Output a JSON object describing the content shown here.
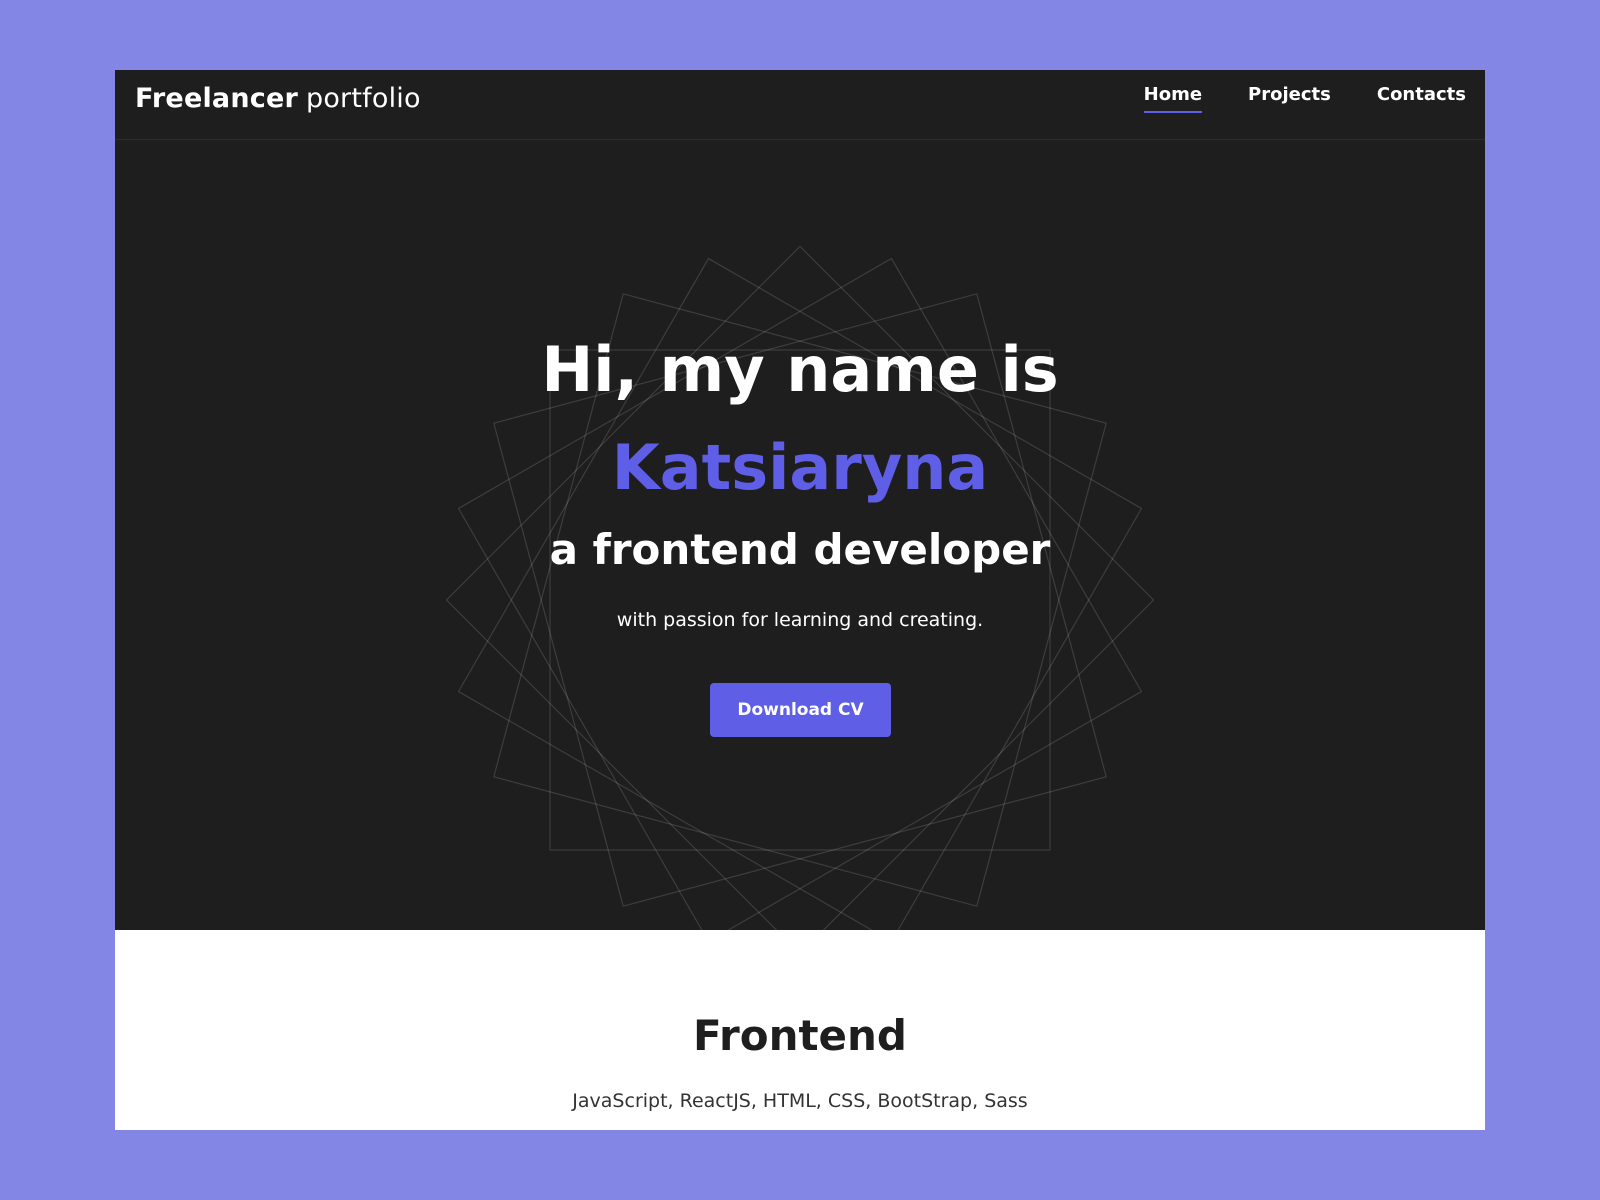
{
  "header": {
    "brand_bold": "Freelancer",
    "brand_light": "portfolio",
    "nav": [
      {
        "label": "Home",
        "active": true
      },
      {
        "label": "Projects",
        "active": false
      },
      {
        "label": "Contacts",
        "active": false
      }
    ]
  },
  "hero": {
    "greeting": "Hi, my name is",
    "name": "Katsiaryna",
    "role": "a frontend developer",
    "tagline": "with passion for learning and creating.",
    "cta_label": "Download CV"
  },
  "skills": {
    "title": "Frontend",
    "list": "JavaScript, ReactJS, HTML, CSS, BootStrap, Sass"
  },
  "colors": {
    "page_background": "#8386e4",
    "dark_background": "#1e1e1f",
    "accent": "#5e5ee6",
    "text_light": "#ffffff",
    "text_dark": "#1e1e1f"
  }
}
